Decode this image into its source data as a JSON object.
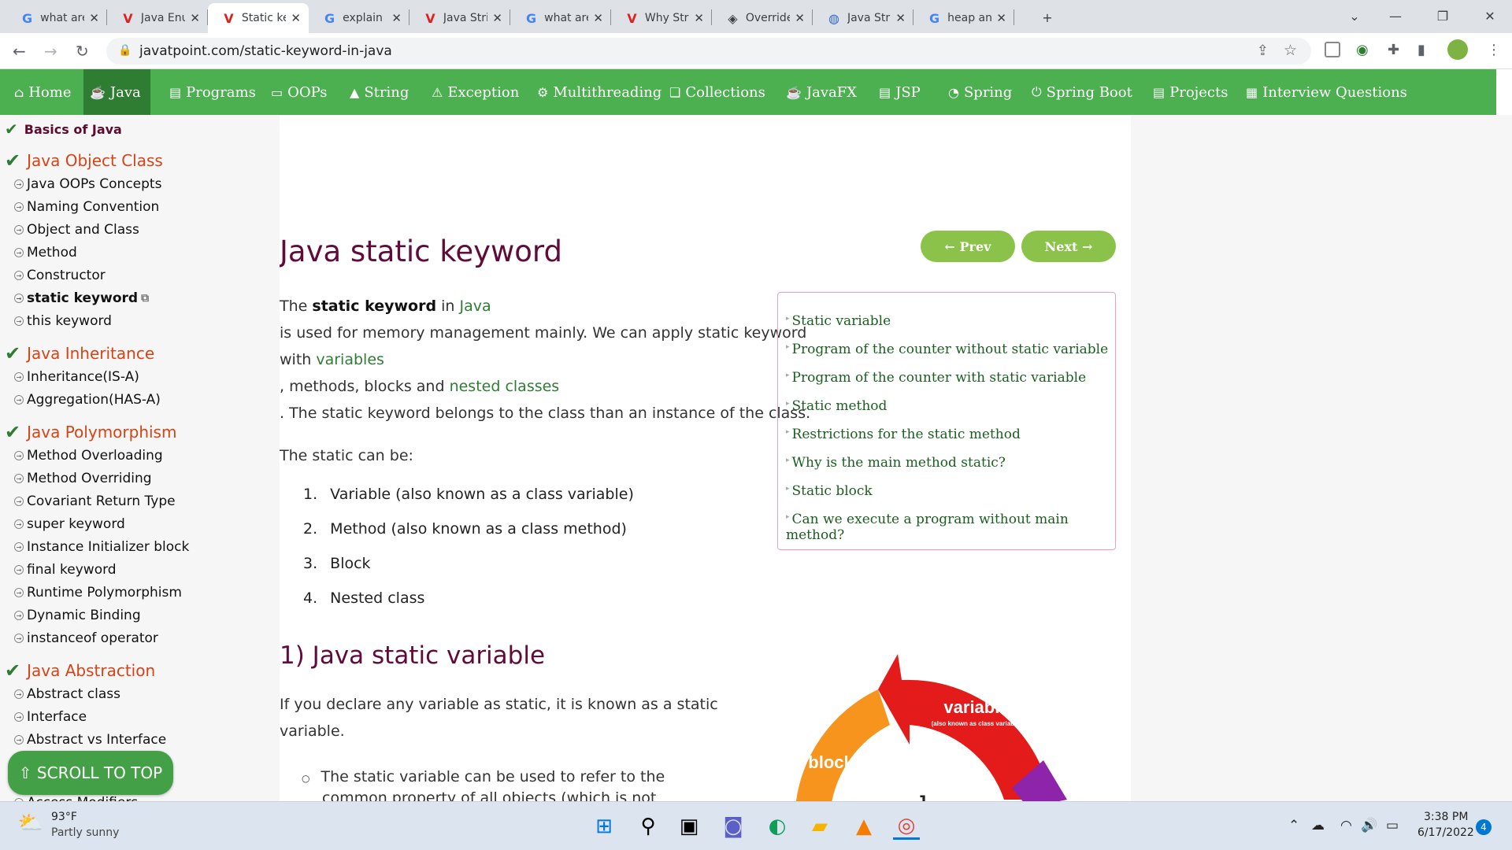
{
  "browser": {
    "tabs": [
      {
        "icon": "google-icon",
        "title": "what are all"
      },
      {
        "icon": "javatpoint-icon",
        "title": "Java Enum"
      },
      {
        "icon": "javatpoint-icon",
        "title": "Static keyw",
        "active": true
      },
      {
        "icon": "google-icon",
        "title": "explain stat"
      },
      {
        "icon": "javatpoint-icon",
        "title": "Java String"
      },
      {
        "icon": "google-icon",
        "title": "what are th"
      },
      {
        "icon": "javatpoint-icon",
        "title": "Why String"
      },
      {
        "icon": "diamond-icon",
        "title": "Override th"
      },
      {
        "icon": "site-icon",
        "title": "Java String"
      },
      {
        "icon": "google-icon",
        "title": "heap and p"
      }
    ],
    "url": "javatpoint.com/static-keyword-in-java"
  },
  "nav": {
    "items": [
      {
        "icon": "home-icon",
        "label": "Home"
      },
      {
        "icon": "java-icon",
        "label": "Java",
        "active": true
      },
      {
        "icon": "programs-icon",
        "label": "Programs"
      },
      {
        "icon": "oops-icon",
        "label": "OOPs"
      },
      {
        "icon": "string-icon",
        "label": "String"
      },
      {
        "icon": "exception-icon",
        "label": "Exception"
      },
      {
        "icon": "multithreading-icon",
        "label": "Multithreading"
      },
      {
        "icon": "collections-icon",
        "label": "Collections"
      },
      {
        "icon": "javafx-icon",
        "label": "JavaFX"
      },
      {
        "icon": "jsp-icon",
        "label": "JSP"
      },
      {
        "icon": "spring-icon",
        "label": "Spring"
      },
      {
        "icon": "springboot-icon",
        "label": "Spring Boot"
      },
      {
        "icon": "projects-icon",
        "label": "Projects"
      },
      {
        "icon": "interview-icon",
        "label": "Interview Questions"
      }
    ]
  },
  "sidebar": {
    "sections": [
      {
        "title": "Basics of Java",
        "items": []
      },
      {
        "title": "Java Object Class",
        "items": [
          "Java OOPs Concepts",
          "Naming Convention",
          "Object and Class",
          "Method",
          "Constructor",
          "static keyword",
          "this keyword"
        ]
      },
      {
        "title": "Java Inheritance",
        "items": [
          "Inheritance(IS-A)",
          "Aggregation(HAS-A)"
        ]
      },
      {
        "title": "Java Polymorphism",
        "items": [
          "Method Overloading",
          "Method Overriding",
          "Covariant Return Type",
          "super keyword",
          "Instance Initializer block",
          "final keyword",
          "Runtime Polymorphism",
          "Dynamic Binding",
          "instanceof operator"
        ]
      },
      {
        "title": "Java Abstraction",
        "items": [
          "Abstract class",
          "Interface",
          "Abstract vs Interface"
        ]
      }
    ],
    "partial_item": "Access Modifiers",
    "scroll_to_top": "⇧ SCROLL TO TOP"
  },
  "main": {
    "title": "Java static keyword",
    "prev": "← Prev",
    "next": "Next →",
    "intro": {
      "t1": "The ",
      "b1": "static keyword",
      "t2": " in ",
      "l1": "Java",
      "line2": "is used for memory management mainly. We can apply static keyword",
      "t3": "with ",
      "l2": "variables",
      "line4a": ", methods, blocks and ",
      "l3": "nested classes",
      "line5": ". The static keyword belongs to the class than an instance of the class."
    },
    "can_be": "The static can be:",
    "list": [
      "Variable (also known as a class variable)",
      "Method (also known as a class method)",
      "Block",
      "Nested class"
    ],
    "toc": [
      "Static variable",
      "Program of the counter without static variable",
      "Program of the counter with static variable",
      "Static method",
      "Restrictions for the static method",
      "Why is the main method static?",
      "Static block",
      "Can we execute a program without main method?"
    ],
    "section1_title": "1) Java static variable",
    "section1_p1": "If you declare any variable as static, it is known as a static",
    "section1_p2": "variable.",
    "bullet1_a": "The static variable can be used to refer to the",
    "bullet1_b": "common property of all objects (which is not",
    "diagram": {
      "variable": "variable",
      "variable_sub": "(also known as class variable)",
      "block": "block",
      "center": "J"
    }
  },
  "taskbar": {
    "temp": "93°F",
    "weather": "Partly sunny",
    "time": "3:38 PM",
    "date": "6/17/2022",
    "badge": "4"
  }
}
